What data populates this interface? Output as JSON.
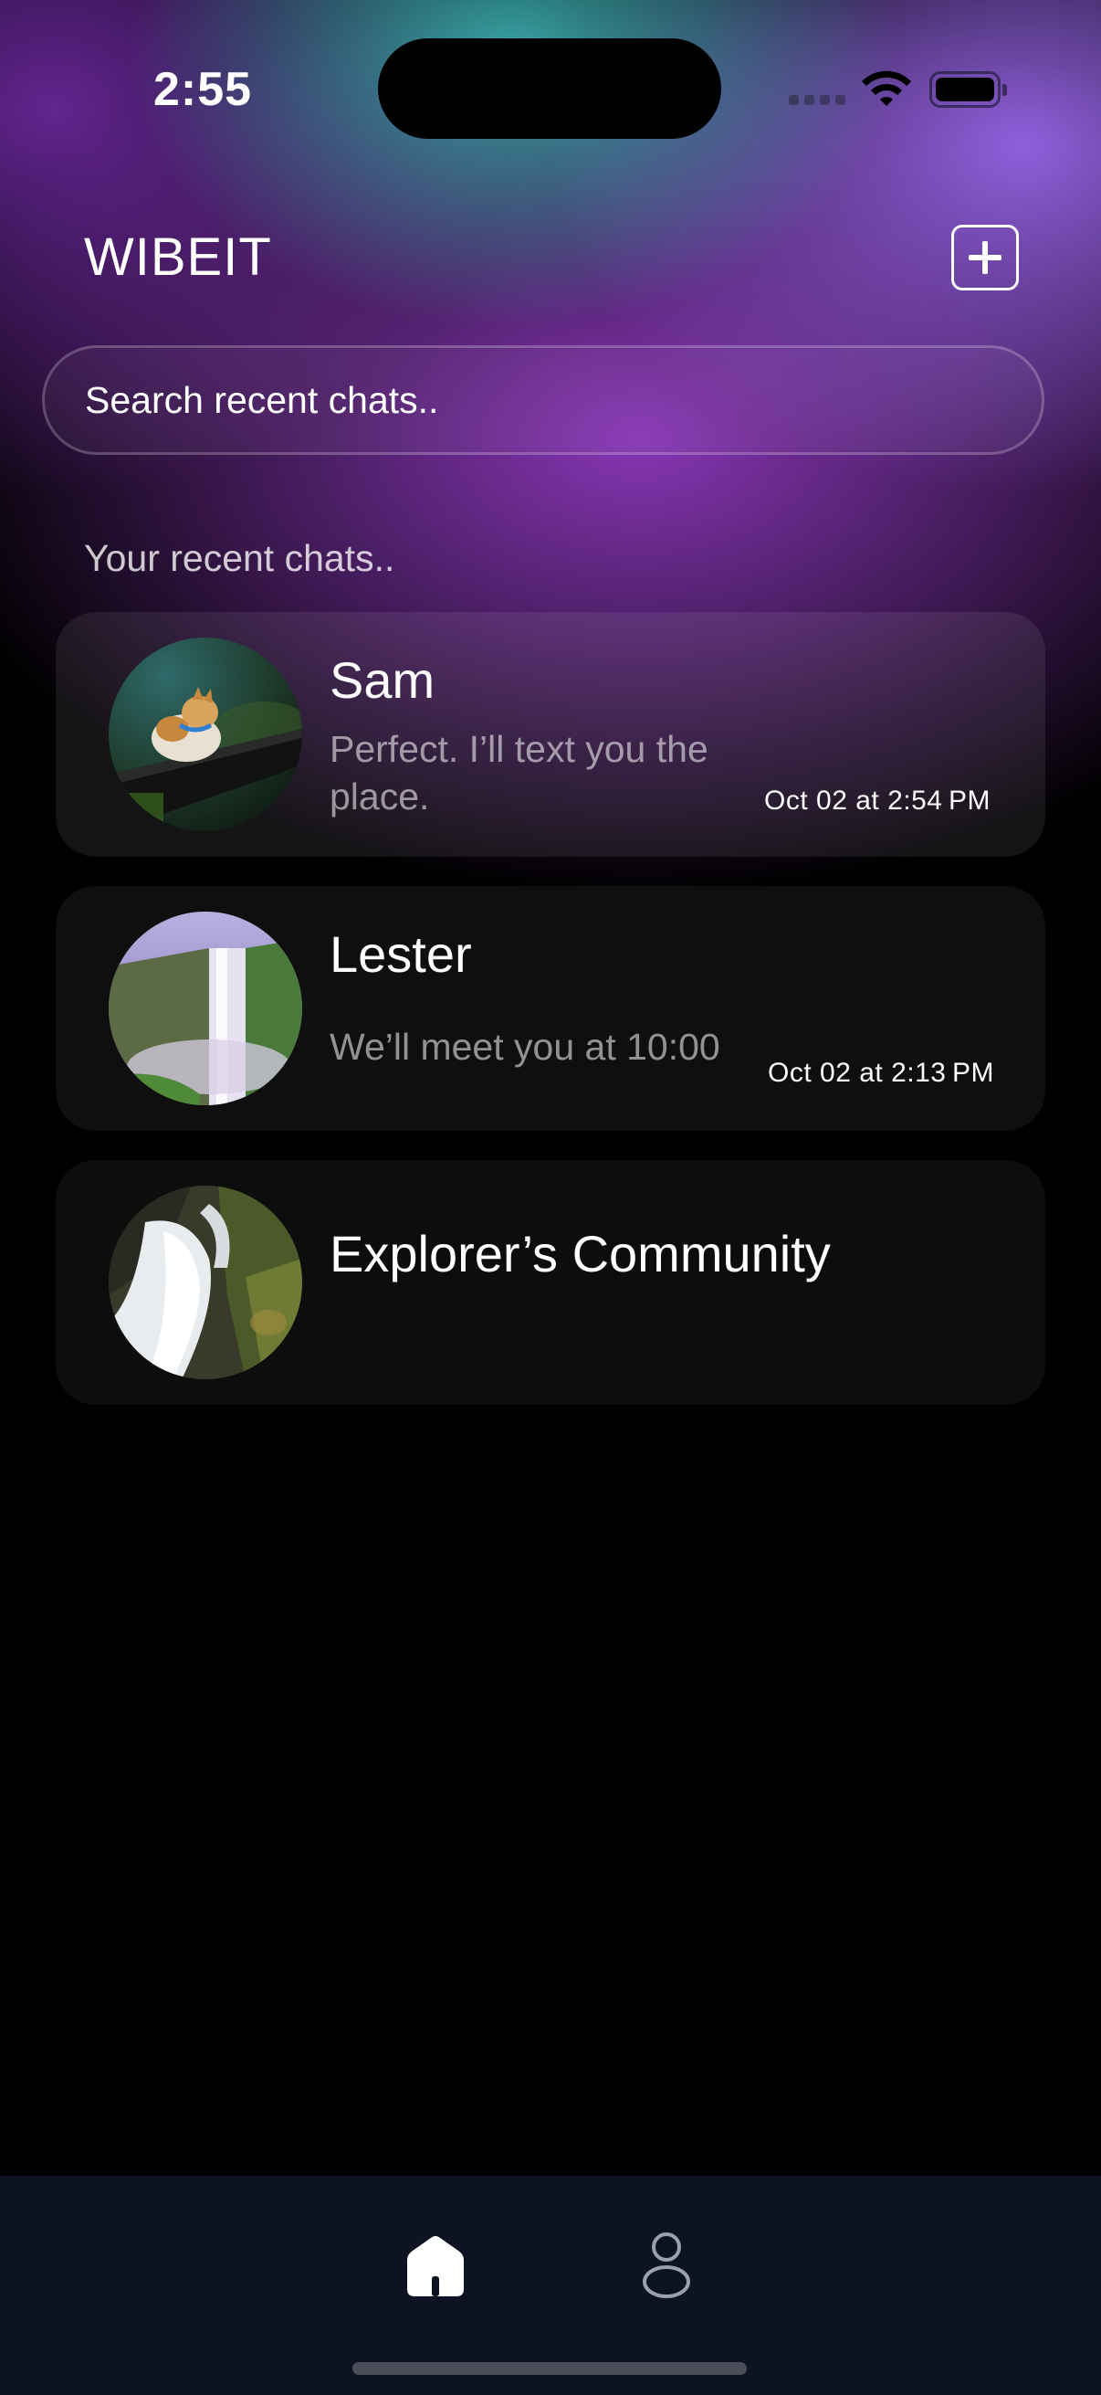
{
  "status_bar": {
    "time": "2:55"
  },
  "header": {
    "title": "WIBEIT",
    "add_icon": "plus-square-icon"
  },
  "search": {
    "placeholder": "Search recent chats.."
  },
  "section": {
    "label": "Your recent chats.."
  },
  "chats": [
    {
      "name": "Sam",
      "preview": "Perfect. I’ll text you the place.",
      "time": "Oct 02 at 2:54 PM",
      "avatar": "cat-photo"
    },
    {
      "name": "Lester",
      "preview": "We’ll meet you at 10:00",
      "time": "Oct 02 at 2:13 PM",
      "avatar": "waterfall-photo"
    },
    {
      "name": "Explorer’s Community",
      "preview": "",
      "time": "",
      "avatar": "waterfall-rocks-photo"
    }
  ],
  "tab_bar": {
    "items": [
      "home-icon",
      "profile-icon"
    ],
    "active": "home-icon"
  },
  "colors": {
    "tab_bar_bg": "#0d1322",
    "accent_purple": "#9a4fd6",
    "accent_teal": "#40bebe"
  }
}
